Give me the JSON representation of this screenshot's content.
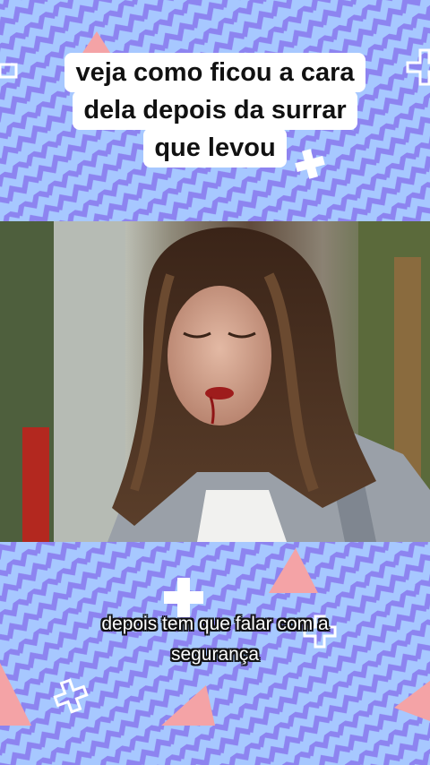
{
  "caption": {
    "lines": [
      "veja como ficou a cara",
      "dela depois da surrar",
      "que levou"
    ]
  },
  "video": {
    "icon": "video-frame"
  },
  "subtitle": {
    "lines": [
      "depois tem que falar com a",
      "segurança"
    ]
  },
  "colors": {
    "background": "#a7c8ff",
    "zigzag": "#8f86f0",
    "accent_triangle": "#f4a3a6",
    "cross": "#ffffff",
    "caption_bg": "#ffffff"
  }
}
